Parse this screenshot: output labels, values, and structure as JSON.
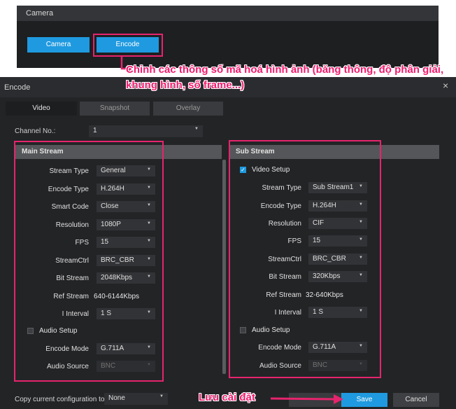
{
  "camera_panel": {
    "title": "Camera",
    "buttons": {
      "camera": "Camera",
      "encode": "Encode"
    }
  },
  "encode_window": {
    "title": "Encode",
    "close_icon": "×",
    "tabs": [
      "Video",
      "Snapshot",
      "Overlay"
    ],
    "channel": {
      "label": "Channel No.:",
      "value": "1"
    },
    "main_stream": {
      "title": "Main Stream",
      "fields": [
        {
          "label": "Stream Type",
          "value": "General"
        },
        {
          "label": "Encode Type",
          "value": "H.264H"
        },
        {
          "label": "Smart Code",
          "value": "Close"
        },
        {
          "label": "Resolution",
          "value": "1080P"
        },
        {
          "label": "FPS",
          "value": "15"
        },
        {
          "label": "StreamCtrl",
          "value": "BRC_CBR"
        },
        {
          "label": "Bit Stream",
          "value": "2048Kbps"
        },
        {
          "label": "Ref Stream",
          "value": "640-6144Kbps"
        },
        {
          "label": "I Interval",
          "value": "1 S"
        }
      ],
      "audio_setup": {
        "label": "Audio Setup",
        "checked": false
      },
      "audio_fields": [
        {
          "label": "Encode Mode",
          "value": "G.711A"
        },
        {
          "label": "Audio Source",
          "value": "BNC"
        }
      ]
    },
    "sub_stream": {
      "title": "Sub Stream",
      "video_setup": {
        "label": "Video Setup",
        "checked": true
      },
      "fields": [
        {
          "label": "Stream Type",
          "value": "Sub Stream1"
        },
        {
          "label": "Encode Type",
          "value": "H.264H"
        },
        {
          "label": "Resolution",
          "value": "CIF"
        },
        {
          "label": "FPS",
          "value": "15"
        },
        {
          "label": "StreamCtrl",
          "value": "BRC_CBR"
        },
        {
          "label": "Bit Stream",
          "value": "320Kbps"
        },
        {
          "label": "Ref Stream",
          "value": "32-640Kbps"
        },
        {
          "label": "I Interval",
          "value": "1 S"
        }
      ],
      "audio_setup": {
        "label": "Audio Setup",
        "checked": false
      },
      "audio_fields": [
        {
          "label": "Encode Mode",
          "value": "G.711A"
        },
        {
          "label": "Audio Source",
          "value": "BNC"
        }
      ]
    },
    "copy_config": {
      "label": "Copy current configuration to",
      "value": "None"
    },
    "footer": {
      "save": "Save",
      "cancel": "Cancel"
    }
  },
  "annotations": {
    "encode_note": "Chỉnh các thông số mã hoá hình ảnh (băng thông, độ phân giải, khung hình, số frame...)",
    "save_note": "Lưu cài đặt",
    "highlight_color": "#e6246e"
  },
  "icons": {
    "dropdown": "chevron-down-icon",
    "close": "close-icon",
    "checkbox": "checkbox-icon",
    "arrow": "arrow-icon"
  }
}
